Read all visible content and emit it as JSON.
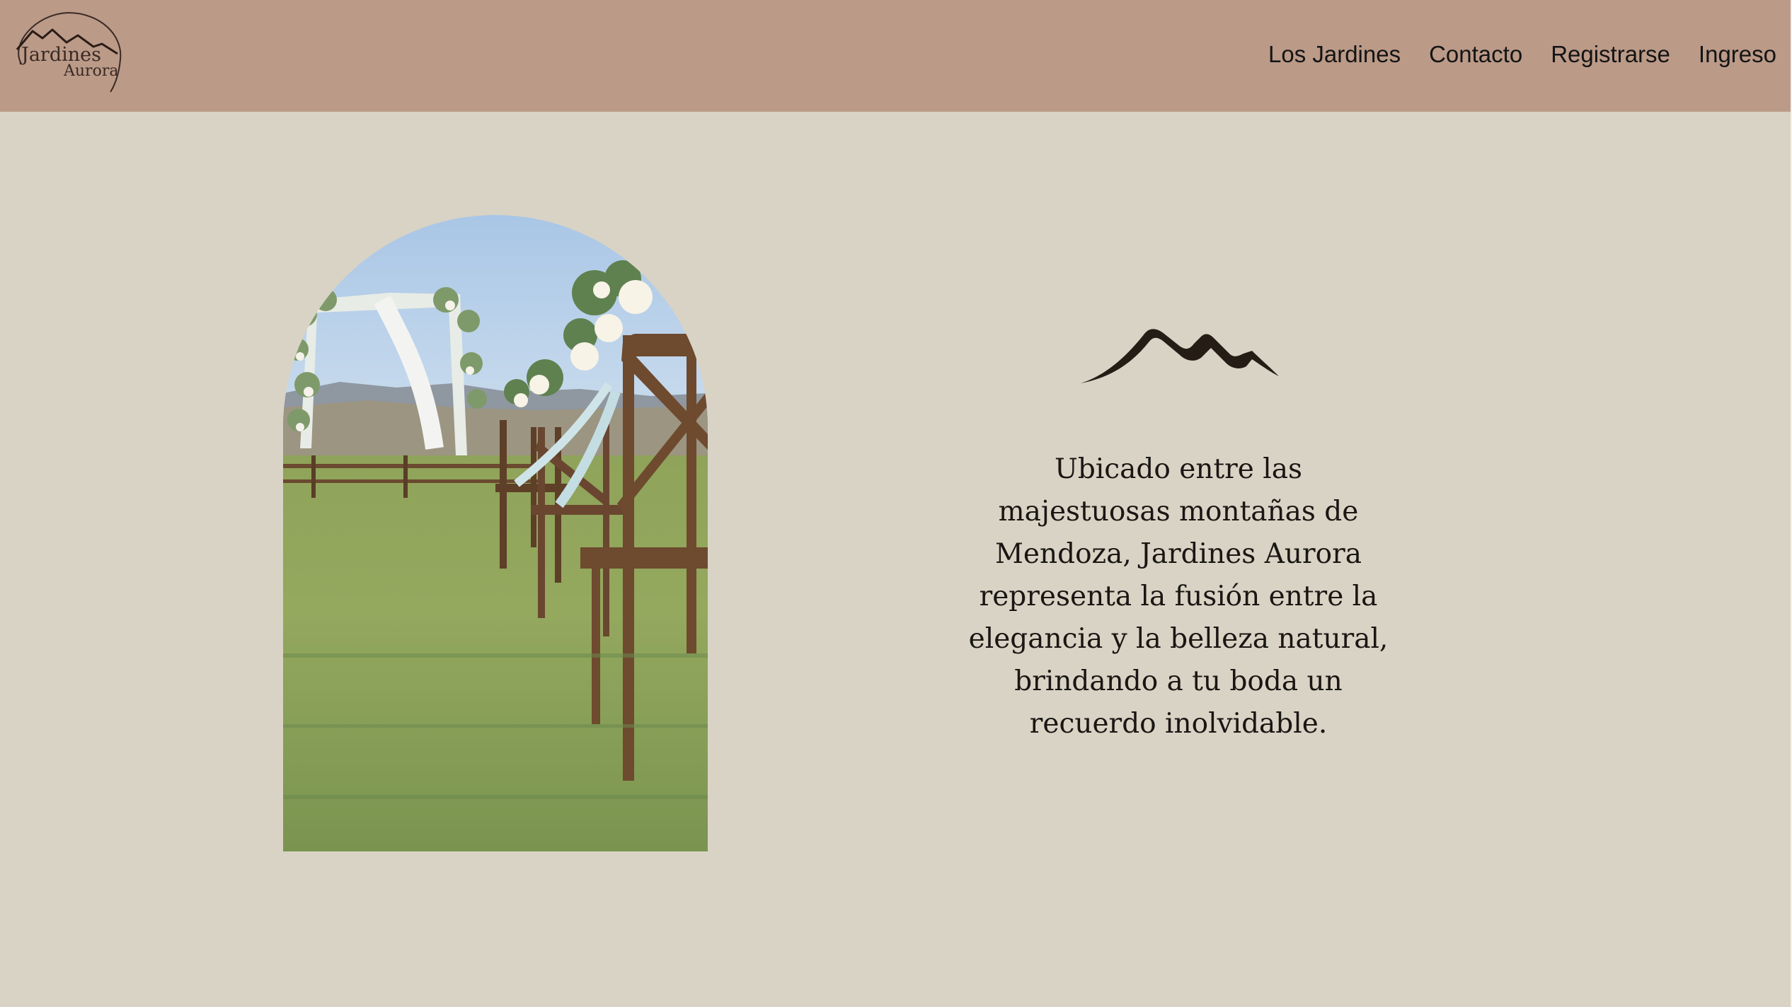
{
  "header": {
    "background": "#bb9a88",
    "logo": {
      "line1": "Jardines",
      "line2": "Aurora",
      "icon": "mountain-logo-icon"
    },
    "nav": [
      {
        "label": "Los Jardines"
      },
      {
        "label": "Contacto"
      },
      {
        "label": "Registrarse"
      },
      {
        "label": "Ingreso"
      }
    ]
  },
  "main": {
    "background": "#d9d3c5",
    "hero_image": {
      "subject": "wedding-ceremony-chairs-and-floral-arch",
      "shape": "arch"
    },
    "decor_icon": "mountain-icon",
    "description": "Ubicado entre las majestuosas montañas de Mendoza, Jardines Aurora representa la fusión entre la elegancia y la belleza natural, brindando a tu boda un recuerdo inolvidable."
  }
}
